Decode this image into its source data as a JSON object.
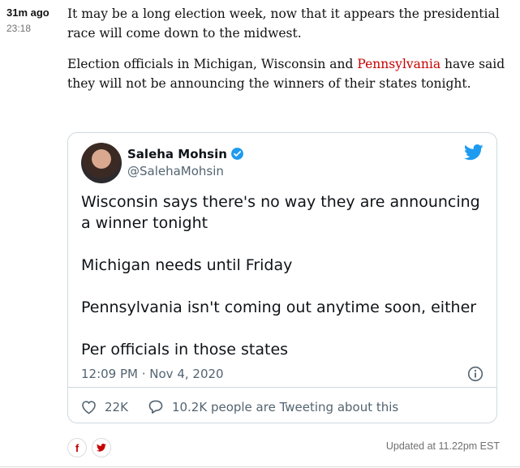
{
  "entry": {
    "ago": "31m ago",
    "time": "23:18",
    "paragraph1": "It may be a long election week, now that it appears the presidential race will come down to the midwest.",
    "paragraph2_before": "Election officials in Michigan, Wisconsin and ",
    "paragraph2_link": "Pennsylvania",
    "paragraph2_after": " have said they will not be announcing the winners of their states tonight."
  },
  "tweet": {
    "name": "Saleha Mohsin",
    "handle": "@SalehaMohsin",
    "lines": [
      "Wisconsin says there's no way they are announcing a winner tonight",
      "Michigan needs until Friday",
      "Pennsylvania isn't coming out anytime soon, either",
      "Per officials in those states"
    ],
    "date": "12:09 PM · Nov 4, 2020",
    "likes": "22K",
    "replies_text": "10.2K people are Tweeting about this"
  },
  "footer": {
    "facebook": "f",
    "updated": "Updated at 11.22pm EST"
  },
  "colors": {
    "link": "#c70000",
    "twitter_blue": "#1d9bf0",
    "muted": "#536471"
  },
  "icons": [
    "verified-badge-icon",
    "twitter-bird-icon",
    "info-icon",
    "heart-icon",
    "speech-bubble-icon",
    "facebook-icon",
    "twitter-share-icon"
  ]
}
